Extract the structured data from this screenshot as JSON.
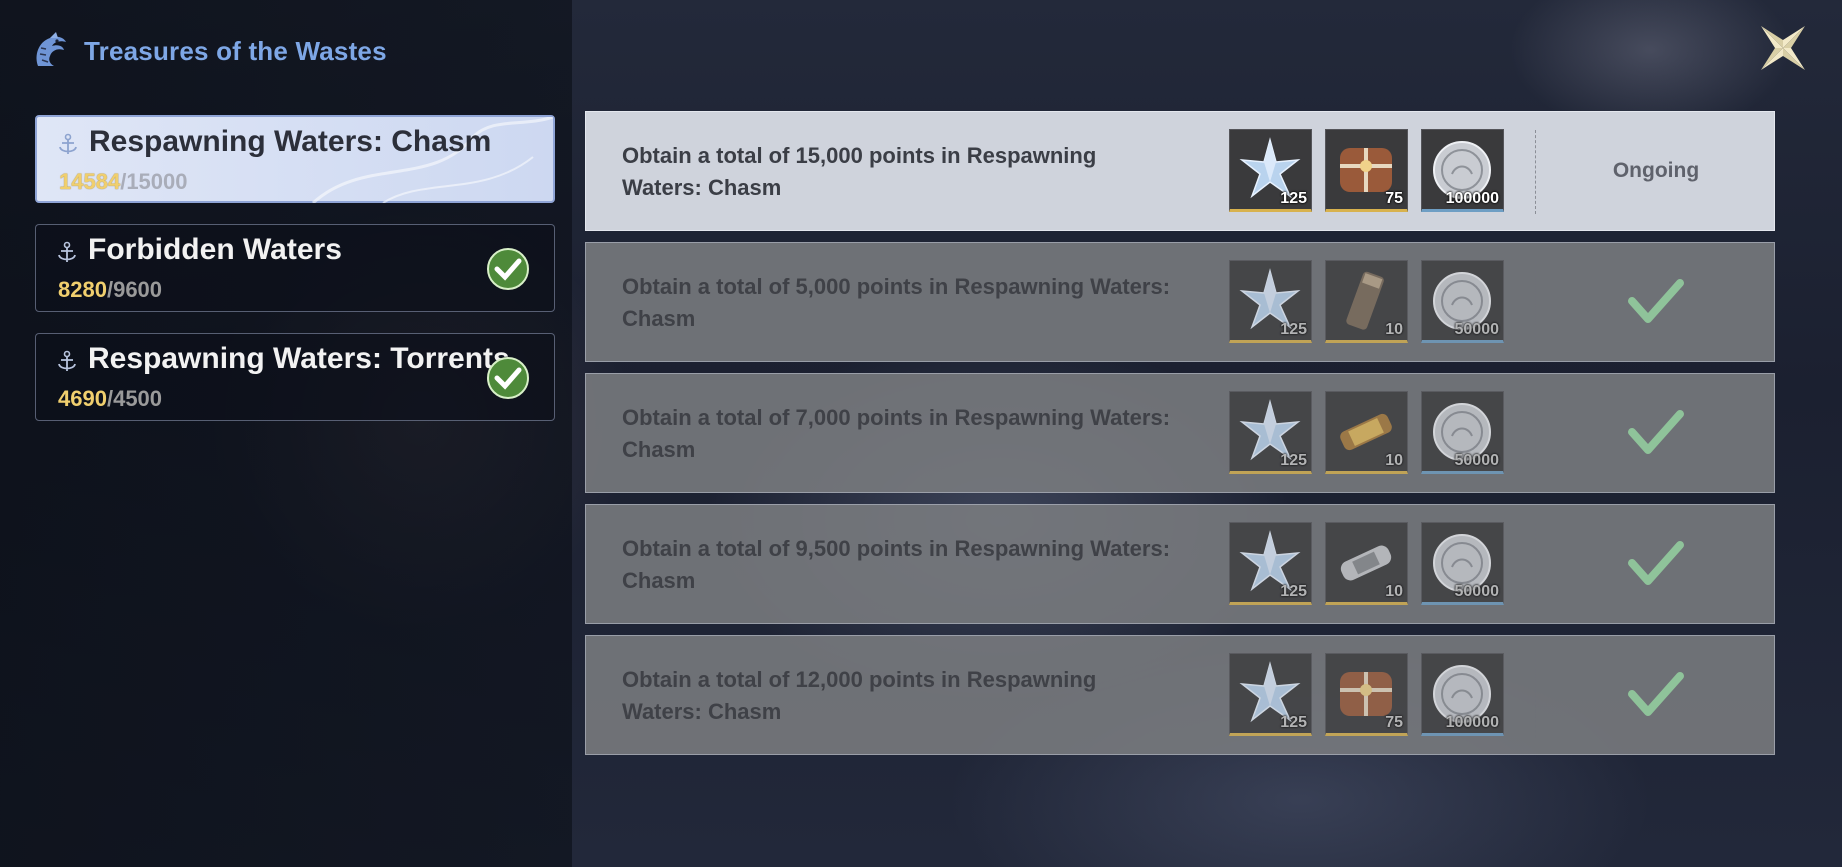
{
  "header": {
    "title": "Treasures of the Wastes",
    "logo_icon": "serpent-emblem-icon",
    "close_icon": "close-icon"
  },
  "colors": {
    "accent": "#7ea7e6",
    "progress_current": "#f0cf6e",
    "check_green": "#6ea86a"
  },
  "tabs": [
    {
      "name": "Respawning Waters: Chasm",
      "current": "14584",
      "separator": "/",
      "max": "15000",
      "completed": false,
      "active": true
    },
    {
      "name": "Forbidden Waters",
      "current": "8280",
      "separator": "/",
      "max": "9600",
      "completed": true,
      "active": false
    },
    {
      "name": "Respawning Waters: Torrents",
      "current": "4690",
      "separator": "/",
      "max": "4500",
      "completed": true,
      "active": false
    }
  ],
  "missions": [
    {
      "description": "Obtain a total of 15,000 points in Respawning Waters: Chasm",
      "status": "Ongoing",
      "rewards": [
        {
          "icon": "star-shard-icon",
          "qty": "125"
        },
        {
          "icon": "treasure-chest-icon",
          "qty": "75"
        },
        {
          "icon": "silver-coin-icon",
          "qty": "100000"
        }
      ]
    },
    {
      "description": "Obtain a total of 5,000 points in Respawning Waters: Chasm",
      "status": "completed",
      "rewards": [
        {
          "icon": "star-shard-icon",
          "qty": "125"
        },
        {
          "icon": "bullet-canister-icon",
          "qty": "10"
        },
        {
          "icon": "silver-coin-icon",
          "qty": "50000"
        }
      ]
    },
    {
      "description": "Obtain a total of 7,000 points in Respawning Waters: Chasm",
      "status": "completed",
      "rewards": [
        {
          "icon": "star-shard-icon",
          "qty": "125"
        },
        {
          "icon": "scroll-canister-icon",
          "qty": "10"
        },
        {
          "icon": "silver-coin-icon",
          "qty": "50000"
        }
      ]
    },
    {
      "description": "Obtain a total of 9,500 points in Respawning Waters: Chasm",
      "status": "completed",
      "rewards": [
        {
          "icon": "star-shard-icon",
          "qty": "125"
        },
        {
          "icon": "battery-capsule-icon",
          "qty": "10"
        },
        {
          "icon": "silver-coin-icon",
          "qty": "50000"
        }
      ]
    },
    {
      "description": "Obtain a total of 12,000 points in Respawning Waters: Chasm",
      "status": "completed",
      "rewards": [
        {
          "icon": "star-shard-icon",
          "qty": "125"
        },
        {
          "icon": "treasure-chest-icon",
          "qty": "75"
        },
        {
          "icon": "silver-coin-icon",
          "qty": "100000"
        }
      ]
    }
  ]
}
